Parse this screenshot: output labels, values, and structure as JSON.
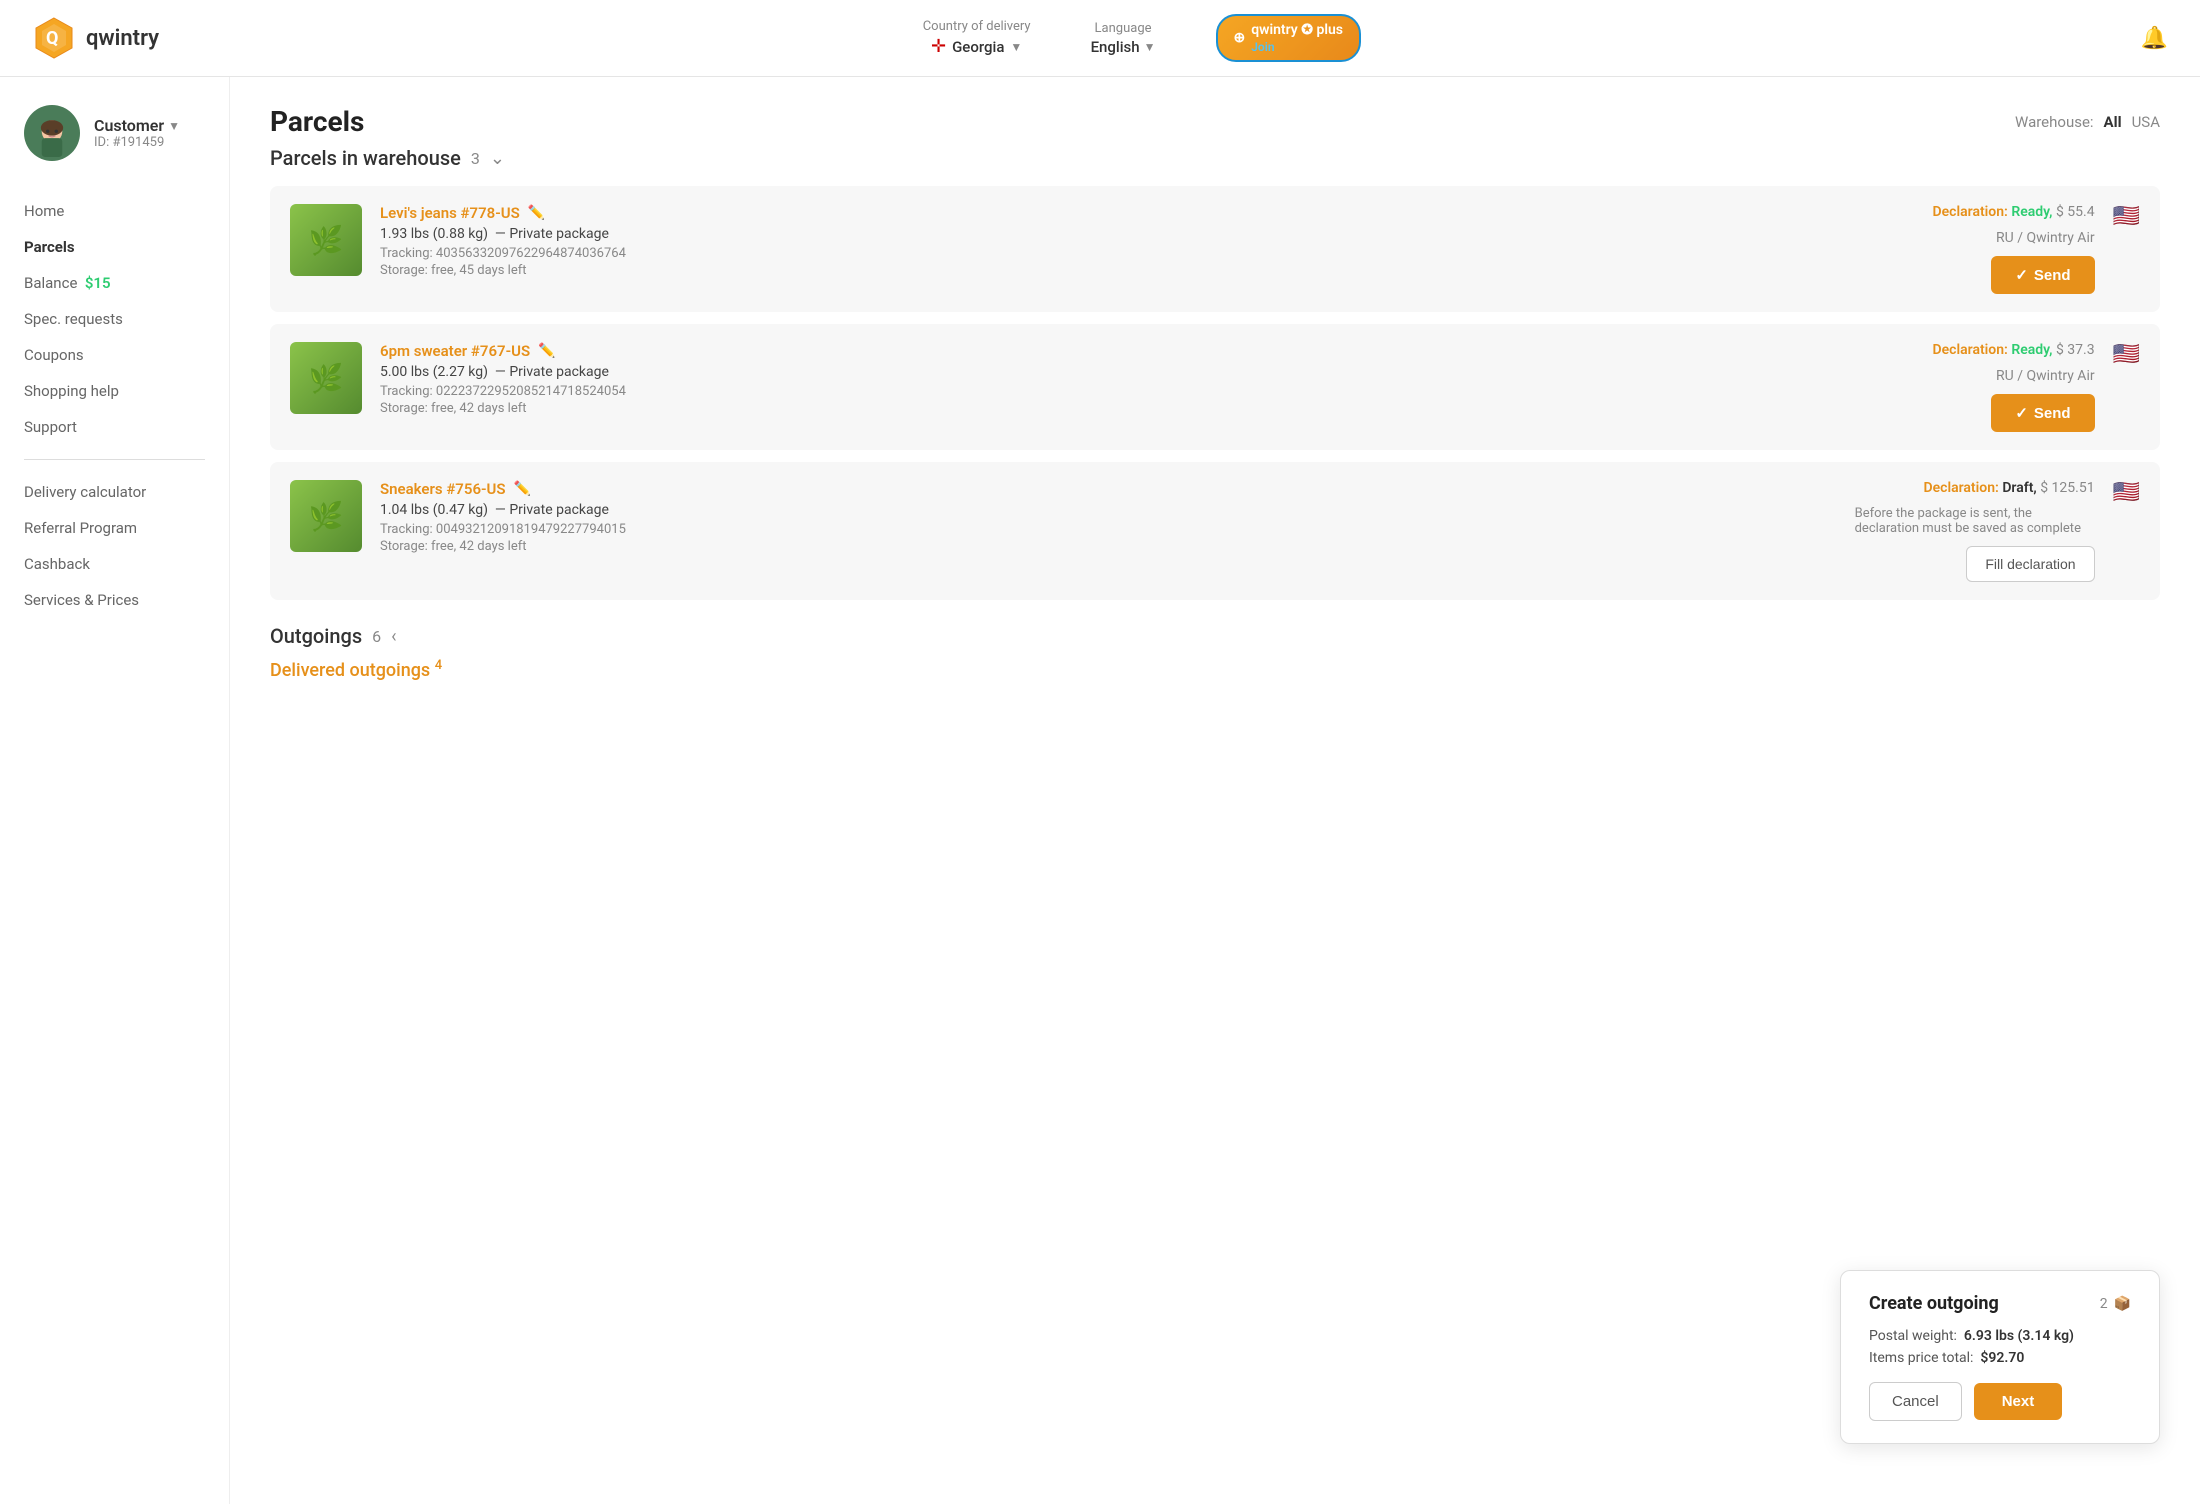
{
  "header": {
    "logo_text": "qwintry",
    "country_label": "Country of delivery",
    "country_value": "Georgia",
    "country_flag": "🏳",
    "language_label": "Language",
    "language_value": "English",
    "plus_badge_text": "qwintry ✪ plus",
    "join_text": "Join",
    "bell_label": "Notifications"
  },
  "sidebar": {
    "user_name": "Customer",
    "user_id": "ID: #191459",
    "nav_items": [
      {
        "label": "Home",
        "active": false,
        "key": "home"
      },
      {
        "label": "Parcels",
        "active": true,
        "key": "parcels"
      },
      {
        "label": "Balance",
        "active": false,
        "key": "balance",
        "extra": "$15"
      },
      {
        "label": "Spec. requests",
        "active": false,
        "key": "spec-requests"
      },
      {
        "label": "Coupons",
        "active": false,
        "key": "coupons"
      },
      {
        "label": "Shopping help",
        "active": false,
        "key": "shopping-help"
      },
      {
        "label": "Support",
        "active": false,
        "key": "support"
      }
    ],
    "nav_items2": [
      {
        "label": "Delivery calculator",
        "key": "delivery-calculator"
      },
      {
        "label": "Referral Program",
        "key": "referral-program"
      },
      {
        "label": "Cashback",
        "key": "cashback"
      },
      {
        "label": "Services & Prices",
        "key": "services-prices"
      }
    ]
  },
  "main": {
    "page_title": "Parcels",
    "warehouse_label": "Warehouse:",
    "warehouse_all": "All",
    "warehouse_usa": "USA",
    "section_title": "Parcels in warehouse",
    "section_count": "3",
    "parcels": [
      {
        "name": "Levi's jeans #778-US",
        "weight_lbs": "1.93 lbs (0.88 kg)",
        "package_type": "Private package",
        "tracking": "Tracking: 403563320976229648740367 64",
        "tracking_full": "40356332097622964874036764",
        "storage": "Storage: free, 45 days left",
        "declaration_label": "Declaration:",
        "declaration_status": "Ready,",
        "declaration_status_type": "ready",
        "price": "$ 55.4",
        "route": "RU / Qwintry Air",
        "send_btn": "Send",
        "flag": "🇺🇸"
      },
      {
        "name": "6pm sweater #767-US",
        "weight_lbs": "5.00 lbs (2.27 kg)",
        "package_type": "Private package",
        "tracking_full": "02223722952085214718524054",
        "storage": "Storage: free, 42 days left",
        "declaration_label": "Declaration:",
        "declaration_status": "Ready,",
        "declaration_status_type": "ready",
        "price": "$ 37.3",
        "route": "RU / Qwintry Air",
        "send_btn": "Send",
        "flag": "🇺🇸"
      },
      {
        "name": "Sneakers #756-US",
        "weight_lbs": "1.04 lbs (0.47 kg)",
        "package_type": "Private package",
        "tracking_full": "00493212091819479227794015",
        "storage": "Storage: free, 42 days left",
        "declaration_label": "Declaration:",
        "declaration_status": "Draft,",
        "declaration_status_type": "draft",
        "price": "$ 125.51",
        "note": "Before the package is sent, the declaration must be saved as complete",
        "fill_btn": "Fill declaration",
        "flag": "🇺🇸"
      }
    ],
    "outgoings_title": "Outgoings",
    "outgoings_count": "6",
    "delivered_label": "Delivered outgoings",
    "delivered_count": "4",
    "create_outgoing": {
      "title": "Create outgoing",
      "package_count": "2",
      "postal_weight_label": "Postal weight:",
      "postal_weight_value": "6.93 lbs (3.14 kg)",
      "items_price_label": "Items price total:",
      "items_price_value": "$92.70",
      "cancel_label": "Cancel",
      "next_label": "Next"
    }
  }
}
